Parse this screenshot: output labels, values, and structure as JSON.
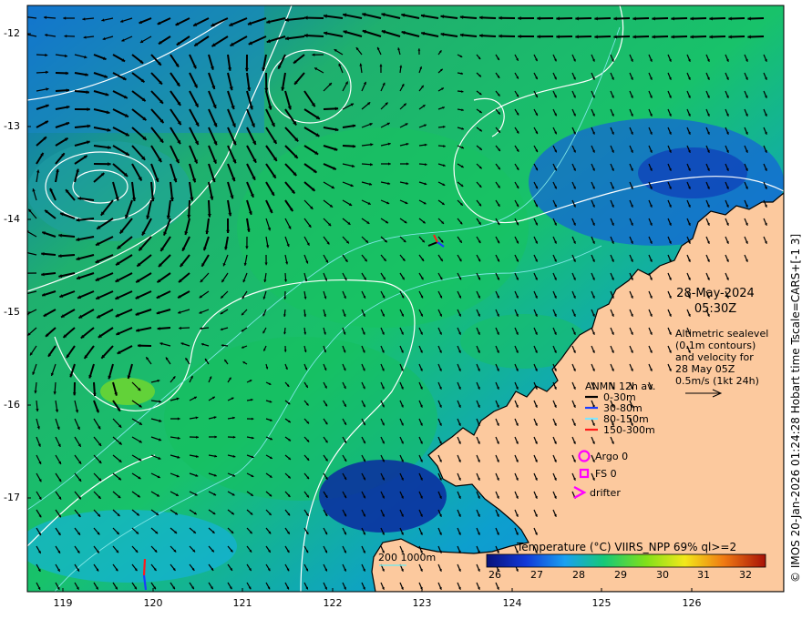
{
  "map": {
    "lat_ticks": [
      "-12",
      "-13",
      "-14",
      "-15",
      "-16",
      "-17"
    ],
    "lon_ticks": [
      "119",
      "120",
      "121",
      "122",
      "123",
      "124",
      "125",
      "126"
    ],
    "side_label": "© IMOS 20-Jan-2026 01:24:28 Hobart time Tscale=CARS+[-1 3]",
    "date_line1": "28-May-2024",
    "date_line2": "05:30Z",
    "info_lines": [
      "Altimetric sealevel",
      "(0.1m contours)",
      "and velocity for",
      "28 May 05Z",
      "0.5m/s (1kt 24h)"
    ],
    "legend": {
      "title": "ANMN 12h av.",
      "items": [
        {
          "label": "0-30m",
          "color": "#000000"
        },
        {
          "label": "30-80m",
          "color": "#1a3cff"
        },
        {
          "label": "80-150m",
          "color": "#7fe6ff"
        },
        {
          "label": "150-300m",
          "color": "#ff1a1a"
        }
      ],
      "argo": "Argo 0",
      "fs": "FS 0",
      "drifter": "drifter",
      "marker_color": "#ff00ff"
    },
    "depth_legend": "200  1000m",
    "colorbar": {
      "title": "Temperature (°C) VIIRS_NPP 69% ql>=2",
      "ticks": [
        "26",
        "27",
        "28",
        "29",
        "30",
        "31",
        "32"
      ]
    },
    "colors": {
      "land": "#fcc99e",
      "coast": "#000000",
      "contour": "#ffffff",
      "isobath": "#7fe6e6"
    }
  }
}
